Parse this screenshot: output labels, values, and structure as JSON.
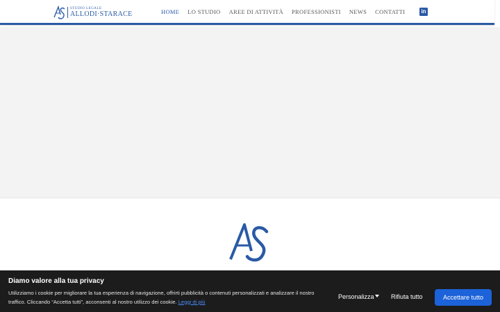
{
  "header": {
    "logo": {
      "monogram": "AS",
      "subtitle": "STUDIO LEGALE",
      "name": "ALLODI·STARACE"
    },
    "nav": [
      {
        "label": "HOME",
        "active": true
      },
      {
        "label": "LO STUDIO",
        "active": false
      },
      {
        "label": "AREE DI ATTIVITÀ",
        "active": false
      },
      {
        "label": "PROFESSIONISTI",
        "active": false
      },
      {
        "label": "NEWS",
        "active": false
      },
      {
        "label": "CONTATTI",
        "active": false
      }
    ],
    "social_icon": "linkedin-icon",
    "accent_color": "#2a5aa6"
  },
  "footer": {
    "logo_monogram": "AS"
  },
  "cookie_banner": {
    "title": "Diamo valore alla tua privacy",
    "text": "Utilizziamo i cookie per migliorare la tua esperienza di navigazione, offrirti pubblicità o contenuti personalizzati e analizzare il nostro traffico. Cliccando “Accetta tutti”, acconsenti al nostro utilizzo dei cookie.",
    "link_label": "Leggi di più",
    "customize_label": "Personalizza",
    "reject_label": "Rifiuta tutto",
    "accept_label": "Accettare tutto",
    "accept_color": "#1c62d8"
  }
}
